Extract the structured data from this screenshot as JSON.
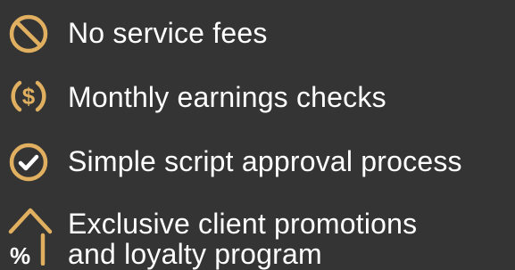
{
  "colors": {
    "background": "#343434",
    "accent": "#e0b060",
    "text": "#ffffff"
  },
  "features": [
    {
      "icon": "no-sign-icon",
      "label": "No service fees"
    },
    {
      "icon": "dollar-circle-icon",
      "label": "Monthly earnings checks"
    },
    {
      "icon": "check-circle-icon",
      "label": "Simple script approval process"
    },
    {
      "icon": "percent-arrow-up-icon",
      "label_lines": [
        "Exclusive client promotions",
        "and loyalty program"
      ]
    }
  ],
  "icon_text": {
    "dollar": "$",
    "percent": "%"
  }
}
